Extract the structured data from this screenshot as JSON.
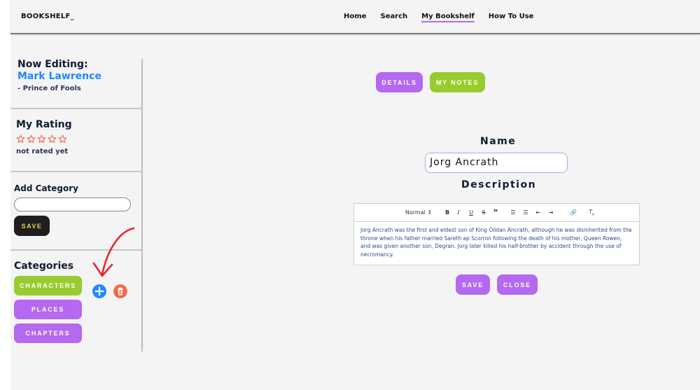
{
  "header": {
    "brand": "BOOKSHELF_",
    "nav": [
      "Home",
      "Search",
      "My Bookshelf",
      "How To Use"
    ]
  },
  "sidebar": {
    "now_editing_label": "Now Editing:",
    "author": "Mark Lawrence",
    "book": "- Prince of Fools",
    "rating_heading": "My Rating",
    "rating_value": 0,
    "rating_max": 5,
    "rating_text": "not rated yet",
    "add_category_heading": "Add Category",
    "add_category_value": "",
    "save_label": "SAVE",
    "categories_heading": "Categories",
    "categories": [
      "CHARACTERS",
      "PLACES",
      "CHAPTERS"
    ]
  },
  "main": {
    "tabs": [
      "DETAILS",
      "MY NOTES"
    ],
    "name_label": "Name",
    "name_value": "Jorg Ancrath",
    "description_label": "Description",
    "editor_format": "Normal",
    "description_text": "Jorg Ancrath was the first and eldest son of King Olidan Ancrath, although he was disinherited from the throne when his father married Sareth ap Scorron following the death of his mother, Queen Rowen, and was given another son, Degran. Jorg later killed his half-brother by accident through the use of necromancy.",
    "save_label": "SAVE",
    "close_label": "CLOSE"
  },
  "colors": {
    "accent_purple": "#b469f0",
    "accent_green": "#98cc2e",
    "author_blue": "#1e88ff",
    "add_blue": "#1e88ff",
    "delete_red": "#f06a4a",
    "annotation_red": "#e5262e"
  },
  "icons": {
    "star": "star-outline-icon",
    "add": "plus-circle-icon",
    "delete": "trash-icon",
    "annotation": "red-arrow-annotation"
  }
}
